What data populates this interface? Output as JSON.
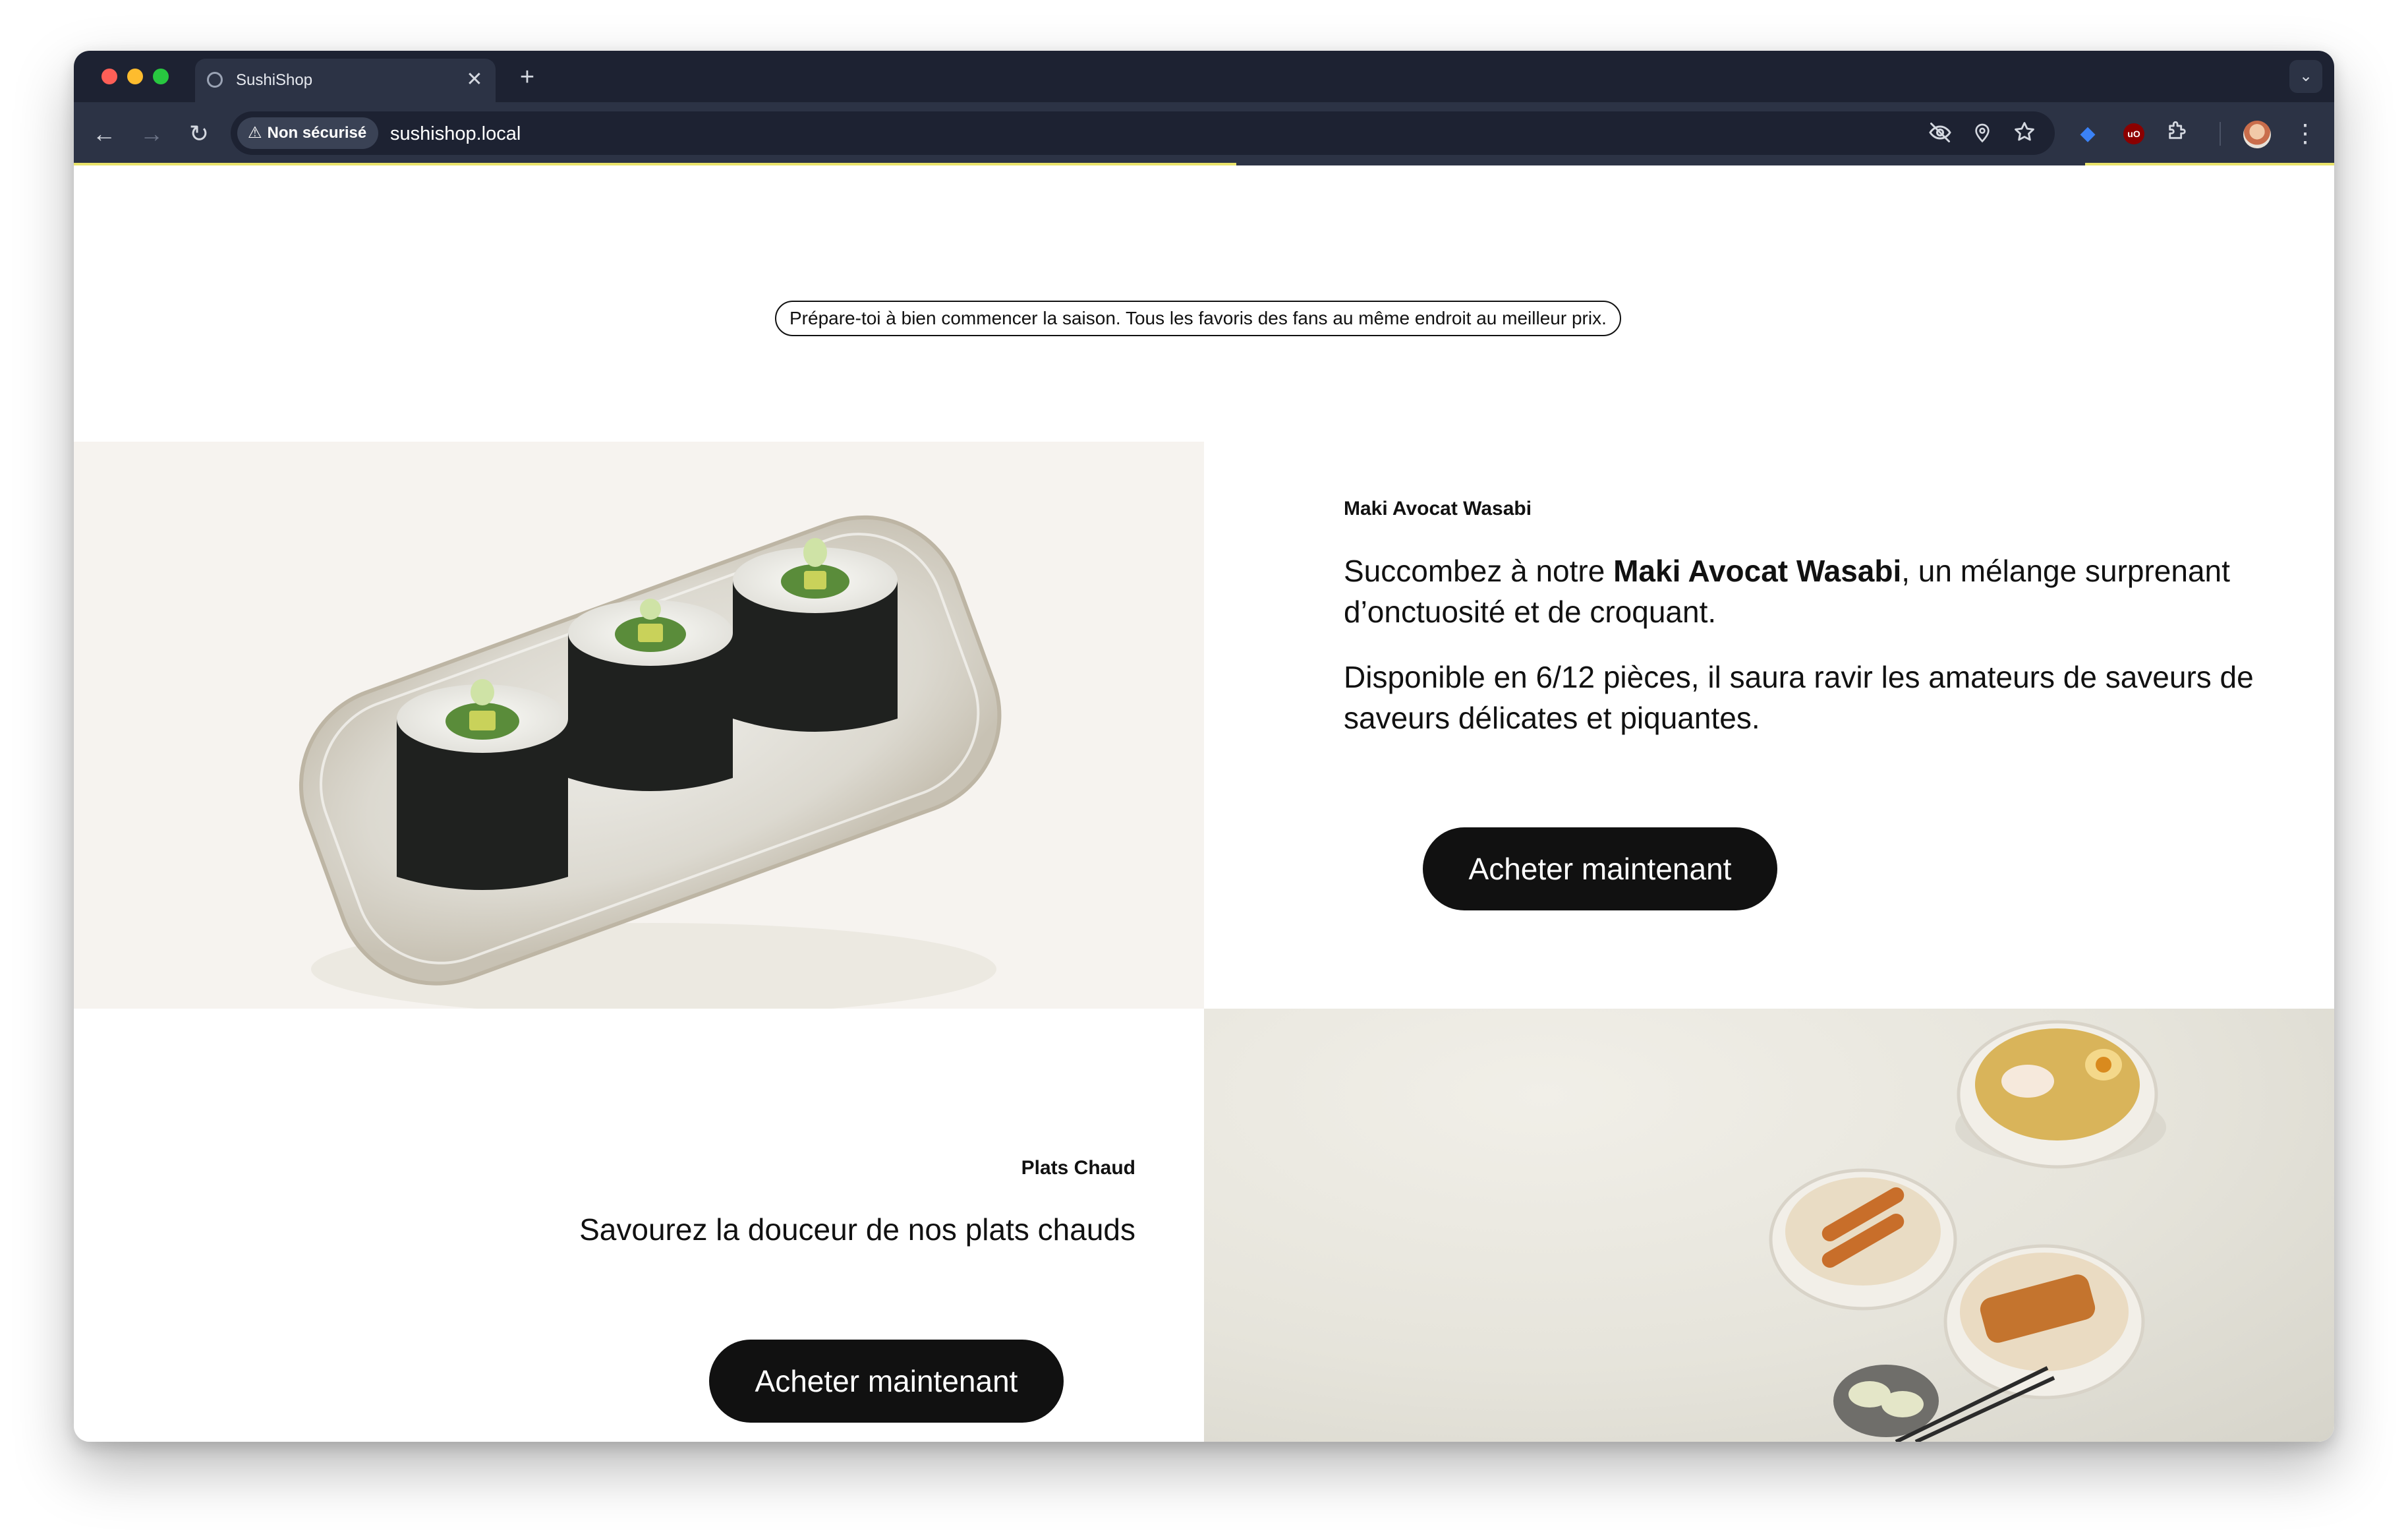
{
  "browser": {
    "tab_title": "SushiShop",
    "tab_close_glyph": "✕",
    "new_tab_glyph": "+",
    "tab_search_glyph": "⌄",
    "back_glyph": "←",
    "forward_glyph": "→",
    "reload_glyph": "↻",
    "security_label": "Non sécurisé",
    "url": "sushishop.local",
    "menu_glyph": "⋮",
    "accent_color": "#1d2232"
  },
  "page": {
    "promo_text": "Prépare-toi à bien commencer la saison. Tous les favoris des fans au même endroit au meilleur prix.",
    "maki": {
      "eyebrow": "Maki Avocat Wasabi",
      "intro_before": "Succombez à notre ",
      "intro_bold": "Maki Avocat Wasabi",
      "intro_after": ", un mélange surprenant d’onctuosité et de croquant.",
      "availability": "Disponible en 6/12 pièces, il saura ravir les amateurs de saveurs de saveurs délicates et piquantes.",
      "cta": "Acheter maintenant"
    },
    "hot": {
      "eyebrow": "Plats Chaud",
      "description": "Savourez la douceur de nos plats chauds",
      "cta": "Acheter maintenant"
    }
  }
}
